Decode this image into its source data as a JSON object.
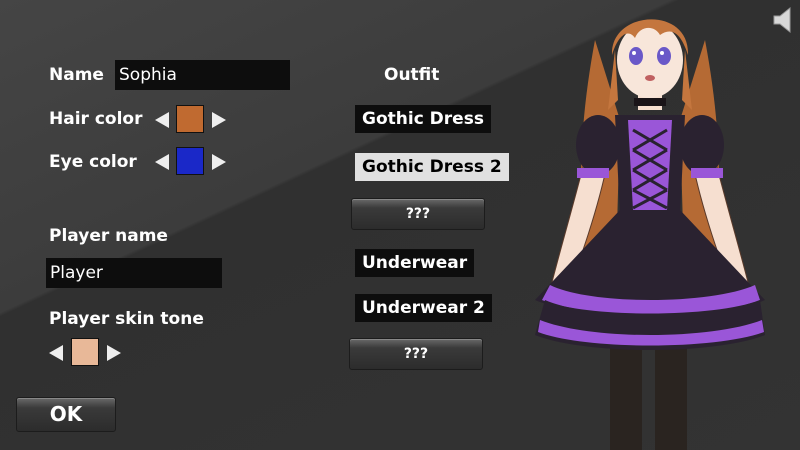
{
  "left": {
    "name_label": "Name",
    "name_value": "Sophia",
    "hair_label": "Hair color",
    "hair_color": "#c06a30",
    "eye_label": "Eye color",
    "eye_color": "#1a28c8",
    "player_name_label": "Player name",
    "player_name_value": "Player",
    "skin_label": "Player skin tone",
    "skin_color": "#e8b898",
    "ok_label": "OK"
  },
  "outfit": {
    "title": "Outfit",
    "items": [
      {
        "label": "Gothic Dress",
        "selected": false
      },
      {
        "label": "Gothic Dress 2",
        "selected": true
      },
      {
        "label": "???",
        "locked": true
      },
      {
        "label": "Underwear",
        "selected": false
      },
      {
        "label": "Underwear 2",
        "selected": false
      },
      {
        "label": "???",
        "locked": true
      }
    ]
  },
  "icons": {
    "speaker": "speaker-icon",
    "arrow_left": "arrow-left-icon",
    "arrow_right": "arrow-right-icon"
  },
  "character": {
    "hair_color": "#c4763e",
    "dress_color": "#2a2230",
    "accent_color": "#9a56d8"
  }
}
